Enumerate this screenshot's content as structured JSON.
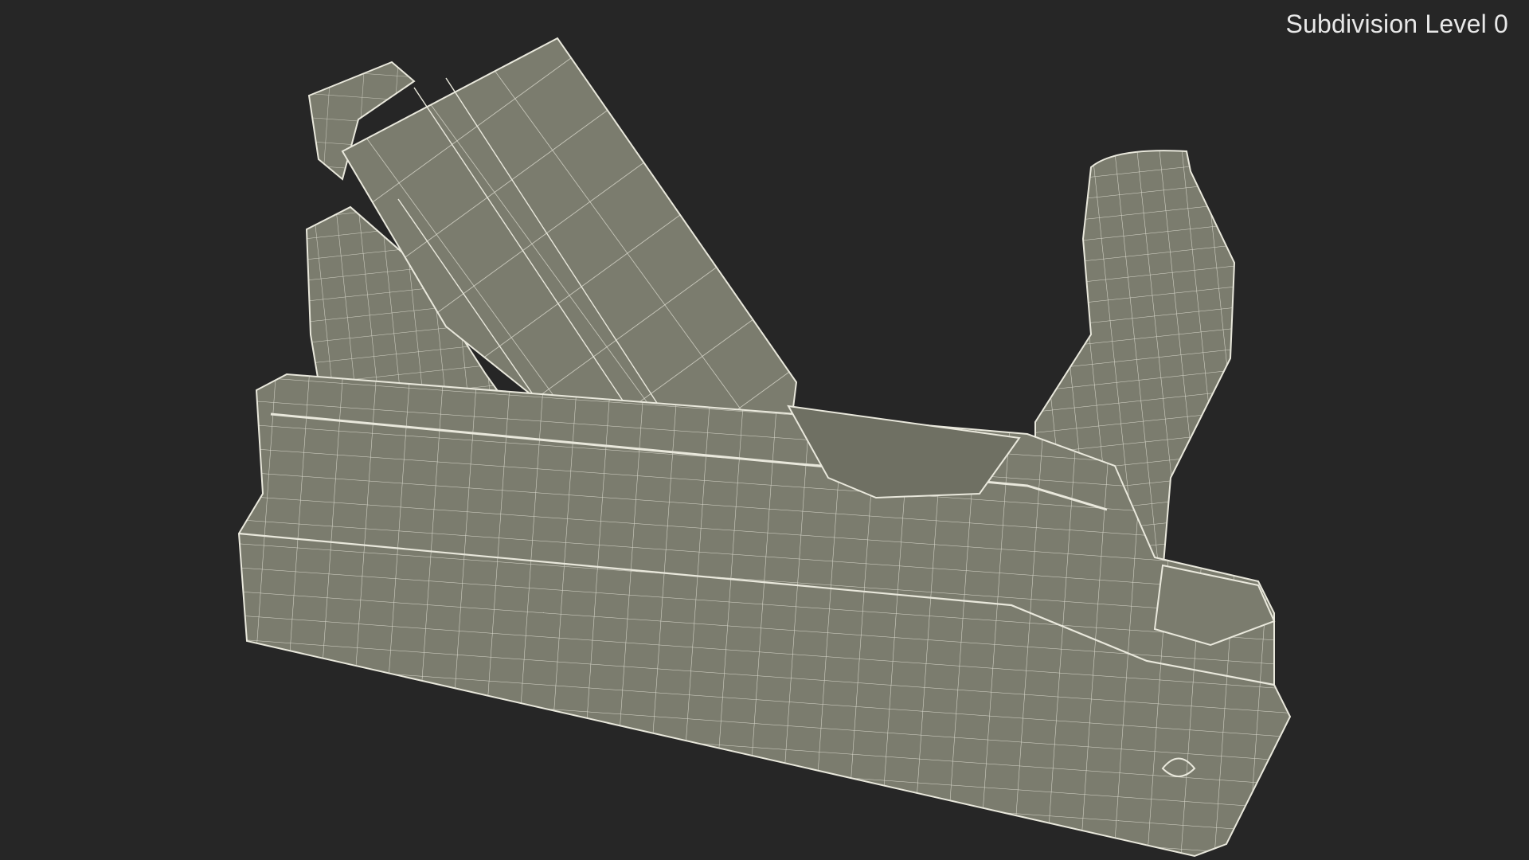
{
  "viewport": {
    "subdivision_label": "Subdivision Level 0",
    "background_color": "#262626",
    "mesh_fill_color": "#7b7c6e",
    "wire_color": "#e9e8dc"
  },
  "model": {
    "subject": "wooden hand plane wireframe"
  }
}
